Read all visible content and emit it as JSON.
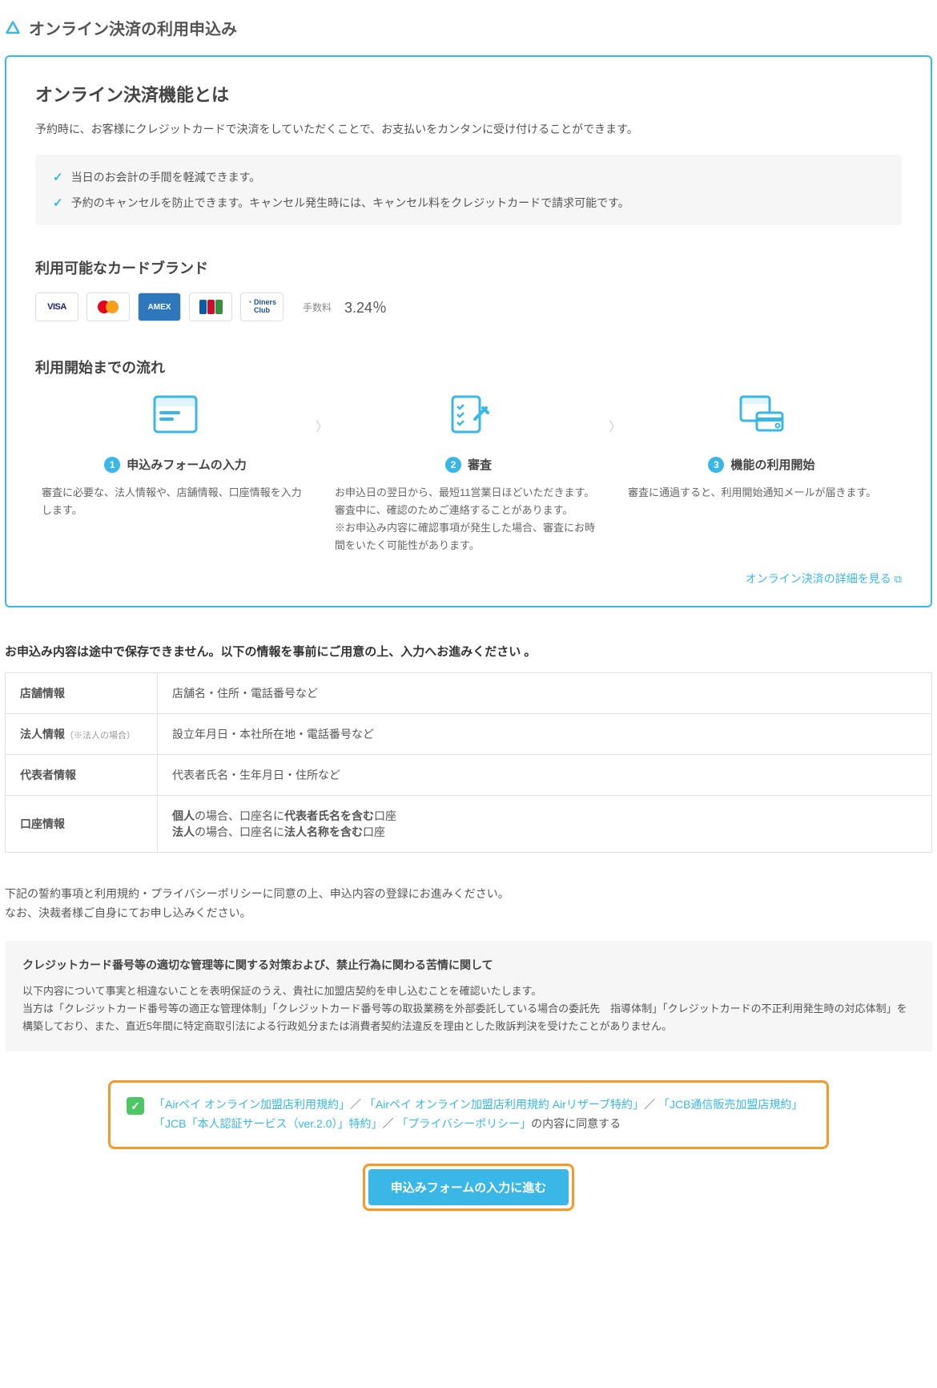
{
  "header": {
    "title": "オンライン決済の利用申込み"
  },
  "card": {
    "title": "オンライン決済機能とは",
    "lead": "予約時に、お客様にクレジットカードで決済をしていただくことで、お支払いをカンタンに受け付けることができます。",
    "benefits": [
      "当日のお会計の手間を軽減できます。",
      "予約のキャンセルを防止できます。キャンセル発生時には、キャンセル料をクレジットカードで請求可能です。"
    ],
    "brands_title": "利用可能なカードブランド",
    "brands": [
      "VISA",
      "Mastercard",
      "Amex",
      "JCB",
      "Diners Club"
    ],
    "fee_label": "手数料",
    "fee_rate": "3.24％",
    "flow_title": "利用開始までの流れ",
    "steps": [
      {
        "num": "1",
        "title": "申込みフォームの入力",
        "desc": "審査に必要な、法人情報や、店舗情報、口座情報を入力します。"
      },
      {
        "num": "2",
        "title": "審査",
        "desc": "お申込日の翌日から、最短11営業日ほどいただきます。\n審査中に、確認のためご連絡することがあります。\n※お申込み内容に確認事項が発生した場合、審査にお時間をいたく可能性があります。"
      },
      {
        "num": "3",
        "title": "機能の利用開始",
        "desc": "審査に通過すると、利用開始通知メールが届きます。"
      }
    ],
    "detail_link": "オンライン決済の詳細を見る"
  },
  "notice": {
    "title": "お申込み内容は途中で保存できません。以下の情報を事前にご用意の上、入力へお進みください 。",
    "rows": [
      {
        "label": "店舗情報",
        "sub": "",
        "value": "店舗名・住所・電話番号など"
      },
      {
        "label": "法人情報",
        "sub": "（※法人の場合）",
        "value": "設立年月日・本社所在地・電話番号など"
      },
      {
        "label": "代表者情報",
        "sub": "",
        "value": "代表者氏名・生年月日・住所など"
      },
      {
        "label": "口座情報",
        "sub": "",
        "value_html": "<b>個人</b>の場合、口座名に<b>代表者氏名を含む</b>口座<br><b>法人</b>の場合、口座名に<b>法人名称を含む</b>口座"
      }
    ]
  },
  "agree": {
    "lead": "下記の誓約事項と利用規約・プライバシーポリシーに同意の上、申込内容の登録にお進みください。\nなお、決裁者様ご自身にてお申し込みください。",
    "complaint_title": "クレジットカード番号等の適切な管理等に関する対策および、禁止行為に関わる苦情に関して",
    "complaint_body": "以下内容について事実と相違ないことを表明保証のうえ、貴社に加盟店契約を申し込むことを確認いたします。\n当方は「クレジットカード番号等の適正な管理体制」「クレジットカード番号等の取扱業務を外部委託している場合の委託先　指導体制」「クレジットカードの不正利用発生時の対応体制」を構築しており、また、直近5年間に特定商取引法による行政処分または消費者契約法違反を理由とした敗訴判決を受けたことがありません。",
    "links": [
      "「Airペイ オンライン加盟店利用規約」",
      "「Airペイ オンライン加盟店利用規約 Airリザーブ特約」",
      "「JCB通信販売加盟店規約」",
      "「JCB「本人認証サービス（ver.2.0）」特約」",
      "「プライバシーポリシー」"
    ],
    "sep": "／",
    "suffix": "の内容に同意する",
    "button": "申込みフォームの入力に進む"
  },
  "colors": {
    "accent": "#3ab7e6",
    "highlight": "#f39a2a",
    "green": "#4cc764"
  }
}
